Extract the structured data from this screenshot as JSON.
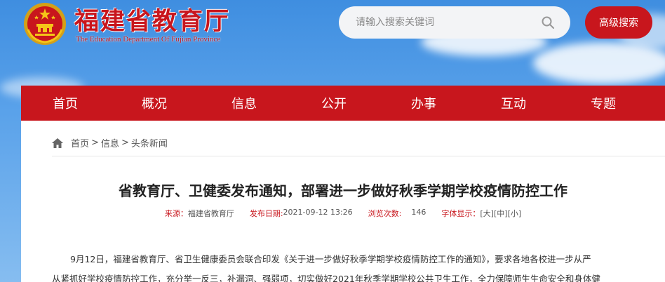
{
  "header": {
    "title": "福建省教育厅",
    "subtitle": "The Education Department Of Fujian Province",
    "search_placeholder": "请输入搜索关键词",
    "advanced_search_label": "高级搜索"
  },
  "nav": {
    "items": [
      "首页",
      "概况",
      "信息",
      "公开",
      "办事",
      "互动",
      "专题"
    ]
  },
  "breadcrumb": {
    "items": [
      "首页",
      "信息",
      "头条新闻"
    ],
    "separator": ">"
  },
  "article": {
    "title": "省教育厅、卫健委发布通知，部署进一步做好秋季学期学校疫情防控工作",
    "source_label": "来源：",
    "source": "福建省教育厅",
    "date_label": "发布日期:",
    "date": "2021-09-12 13:26",
    "views_label": "浏览次数:",
    "views": "146",
    "font_label": "字体显示：",
    "font_large": "[大]",
    "font_medium": "[中]",
    "font_small": "[小]",
    "paragraph_line1": "9月12日，福建省教育厅、省卫生健康委员会联合印发《关于进一步做好秋季学期学校疫情防控工作的通知》，要求各地各校进一步从严",
    "paragraph_line2": "从紧抓好学校疫情防控工作，充分举一反三，补漏洞、强弱项，切实做好2021年秋季学期学校公共卫生工作，全力保障师生生命安全和身体健"
  },
  "colors": {
    "brand_red": "#c8161d",
    "sky_blue": "#5aa2ea"
  },
  "icons": [
    "national-emblem-icon",
    "search-icon",
    "home-icon"
  ]
}
